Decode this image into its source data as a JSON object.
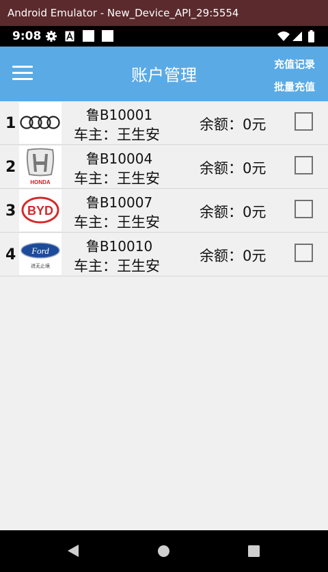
{
  "window": {
    "title": "Android Emulator - New_Device_API_29:5554"
  },
  "status_bar": {
    "time": "9:08"
  },
  "app_bar": {
    "title": "账户管理",
    "recharge_records_label": "充值记录",
    "batch_recharge_label": "批量充值",
    "color": "#5aaae6"
  },
  "accounts": [
    {
      "index": "1",
      "brand_logo": "audi-logo",
      "plate": "鲁B10001",
      "owner": "车主：王生安",
      "balance": "余额：0元",
      "checked": false
    },
    {
      "index": "2",
      "brand_logo": "honda-logo",
      "brand_text": "HONDA",
      "plate": "鲁B10004",
      "owner": "车主：王生安",
      "balance": "余额：0元",
      "checked": false
    },
    {
      "index": "3",
      "brand_logo": "byd-logo",
      "brand_text": "BYD",
      "plate": "鲁B10007",
      "owner": "车主：王生安",
      "balance": "余额：0元",
      "checked": false
    },
    {
      "index": "4",
      "brand_logo": "ford-logo",
      "brand_text": "Ford",
      "brand_subtext": "进无止境",
      "plate": "鲁B10010",
      "owner": "车主：王生安",
      "balance": "余额：0元",
      "checked": false
    }
  ]
}
